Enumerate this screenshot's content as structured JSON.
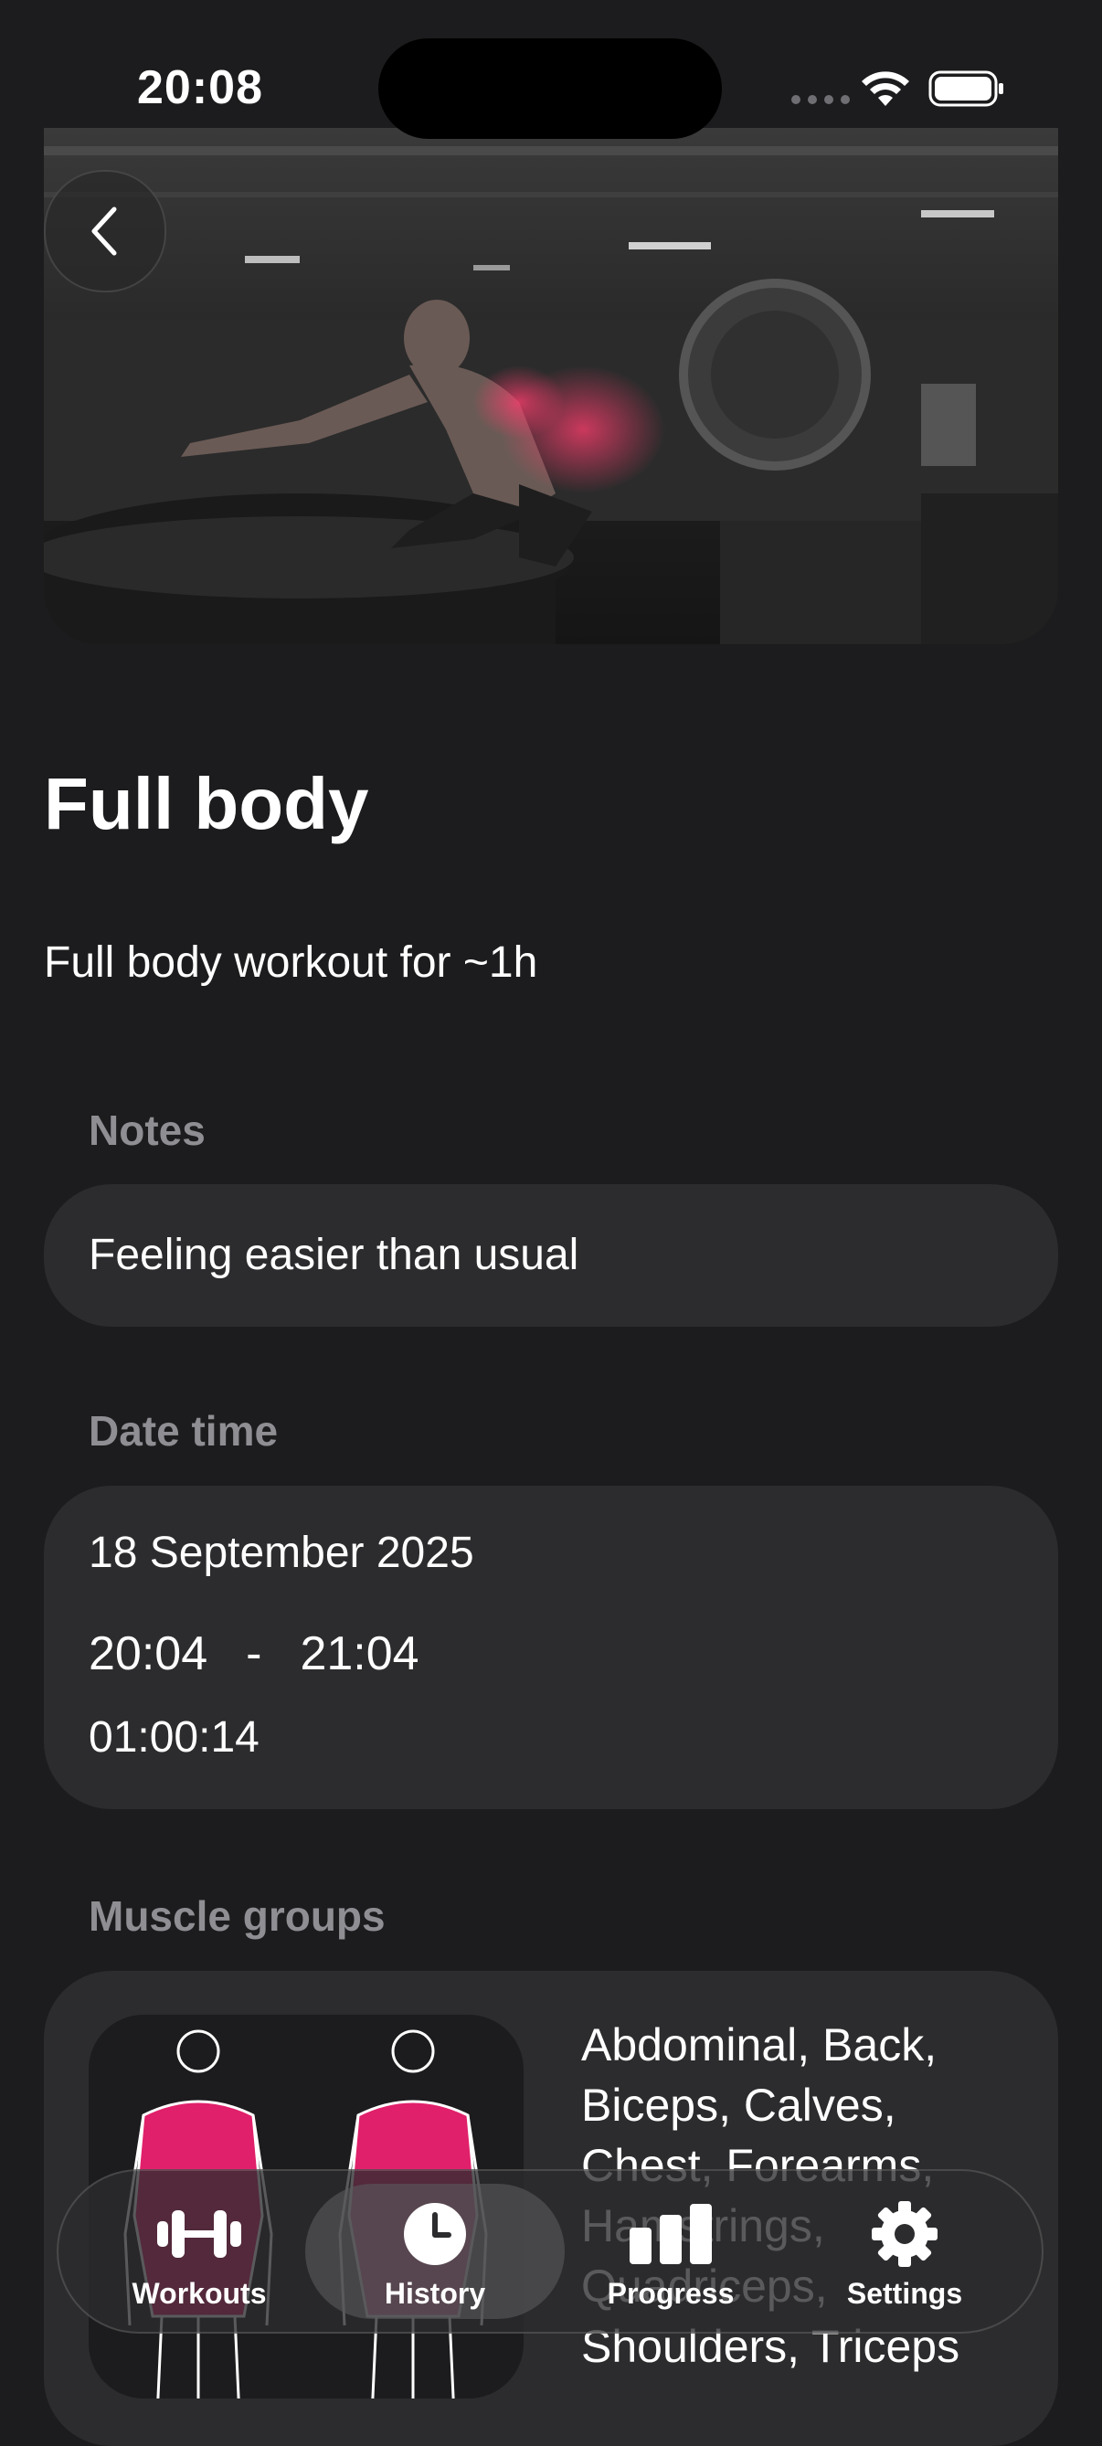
{
  "status_bar": {
    "time": "20:08"
  },
  "header": {
    "back_icon": "chevron-left-icon"
  },
  "workout": {
    "title": "Full body",
    "description": "Full body workout for ~1h"
  },
  "notes": {
    "label": "Notes",
    "value": "Feeling easier than usual"
  },
  "date_time": {
    "label": "Date time",
    "date": "18 September 2025",
    "start": "20:04",
    "separator": "-",
    "end": "21:04",
    "duration": "01:00:14"
  },
  "muscle_groups": {
    "label": "Muscle groups",
    "list": "Abdominal, Back, Biceps, Calves, Chest, Forearms, Hamstrings, Quadriceps, Shoulders, Triceps"
  },
  "tab_bar": {
    "tabs": [
      {
        "label": "Workouts",
        "icon": "dumbbell-icon"
      },
      {
        "label": "History",
        "icon": "clock-icon",
        "active": true
      },
      {
        "label": "Progress",
        "icon": "bar-chart-icon"
      },
      {
        "label": "Settings",
        "icon": "gear-icon"
      }
    ]
  },
  "colors": {
    "background": "#1c1c1e",
    "card": "#2c2c2e",
    "label": "#8e8e93",
    "muscle_highlight": "#e0206a"
  }
}
